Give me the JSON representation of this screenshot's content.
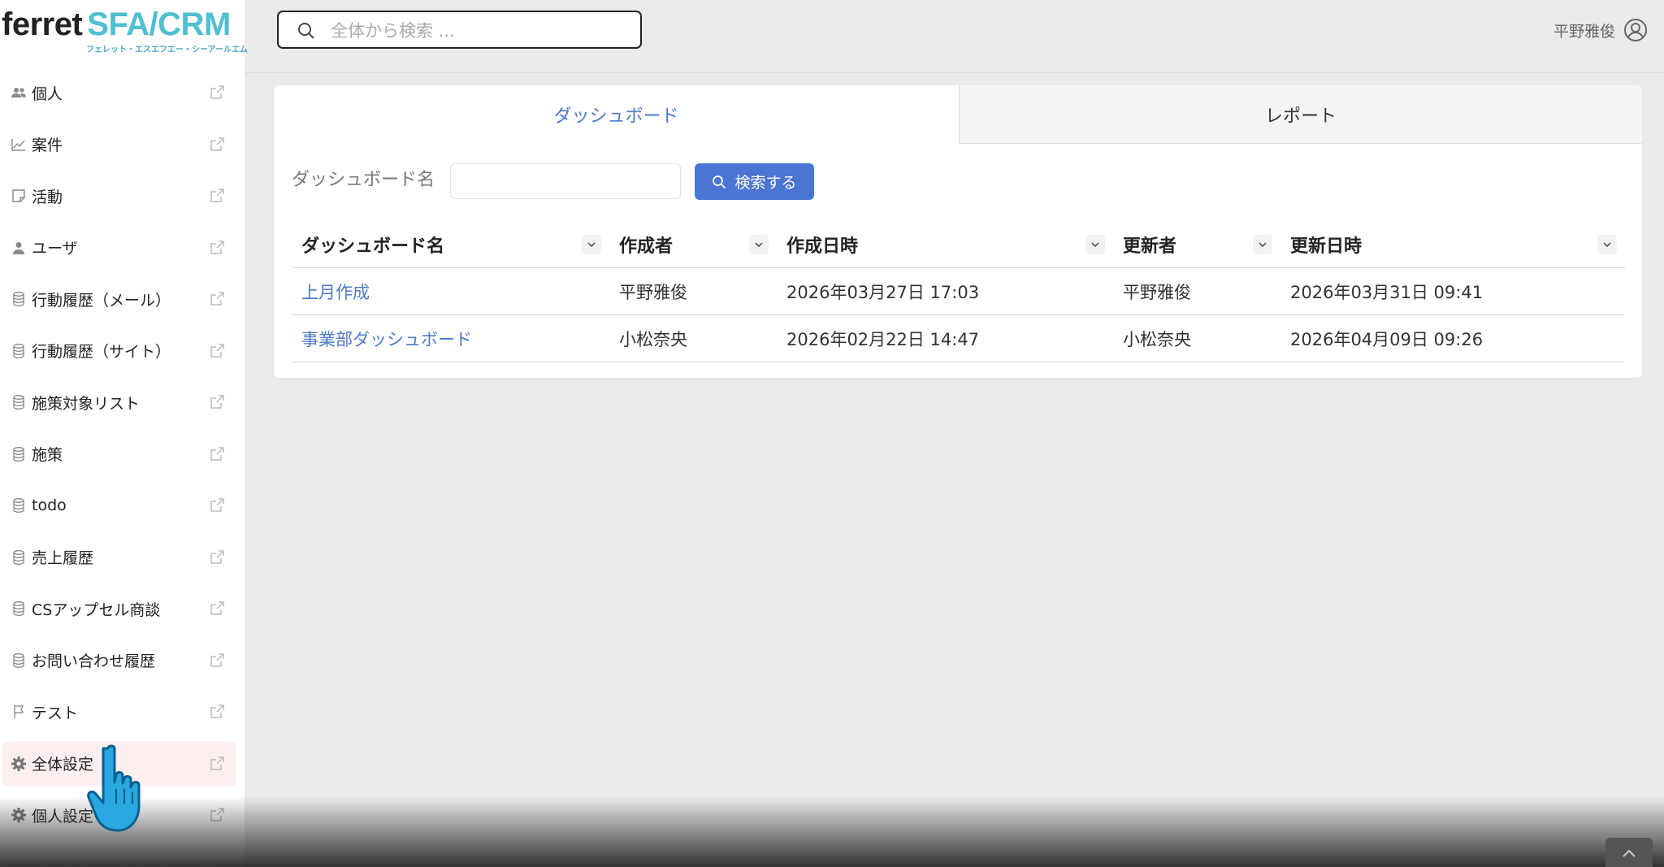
{
  "app": {
    "logo_main": "ferret",
    "logo_accent": "SFA/CRM",
    "logo_sub": "フェレット・エスエフエー・シーアールエム",
    "brand_color": "#4fbfd1",
    "accent_color": "#4a75d3"
  },
  "header": {
    "search_placeholder": "全体から検索 ...",
    "user_name": "平野雅俊"
  },
  "sidebar": {
    "items": [
      {
        "label": "個人",
        "icon": "people-icon"
      },
      {
        "label": "案件",
        "icon": "chart-line-icon"
      },
      {
        "label": "活動",
        "icon": "note-icon"
      },
      {
        "label": "ユーザ",
        "icon": "user-icon"
      },
      {
        "label": "行動履歴（メール）",
        "icon": "database-icon"
      },
      {
        "label": "行動履歴（サイト）",
        "icon": "database-icon"
      },
      {
        "label": "施策対象リスト",
        "icon": "database-icon"
      },
      {
        "label": "施策",
        "icon": "database-icon"
      },
      {
        "label": "todo",
        "icon": "database-icon"
      },
      {
        "label": "売上履歴",
        "icon": "database-icon"
      },
      {
        "label": "CSアップセル商談",
        "icon": "database-icon"
      },
      {
        "label": "お問い合わせ履歴",
        "icon": "database-icon"
      },
      {
        "label": "テスト",
        "icon": "flag-icon"
      },
      {
        "label": "全体設定",
        "icon": "gear-icon",
        "active": true
      },
      {
        "label": "個人設定",
        "icon": "gear-icon"
      }
    ]
  },
  "tabs": [
    {
      "label": "ダッシュボード",
      "active": true
    },
    {
      "label": "レポート",
      "active": false
    }
  ],
  "filter": {
    "label": "ダッシュボード名",
    "value": "",
    "button_label": "検索する"
  },
  "table": {
    "columns": [
      "ダッシュボード名",
      "作成者",
      "作成日時",
      "更新者",
      "更新日時"
    ],
    "rows": [
      {
        "name": "上月作成",
        "creator": "平野雅俊",
        "created": "2026年03月27日 17:03",
        "updater": "平野雅俊",
        "updated": "2026年03月31日 09:41"
      },
      {
        "name": "事業部ダッシュボード",
        "creator": "小松奈央",
        "created": "2026年02月22日 14:47",
        "updater": "小松奈央",
        "updated": "2026年04月09日 09:26"
      }
    ]
  }
}
